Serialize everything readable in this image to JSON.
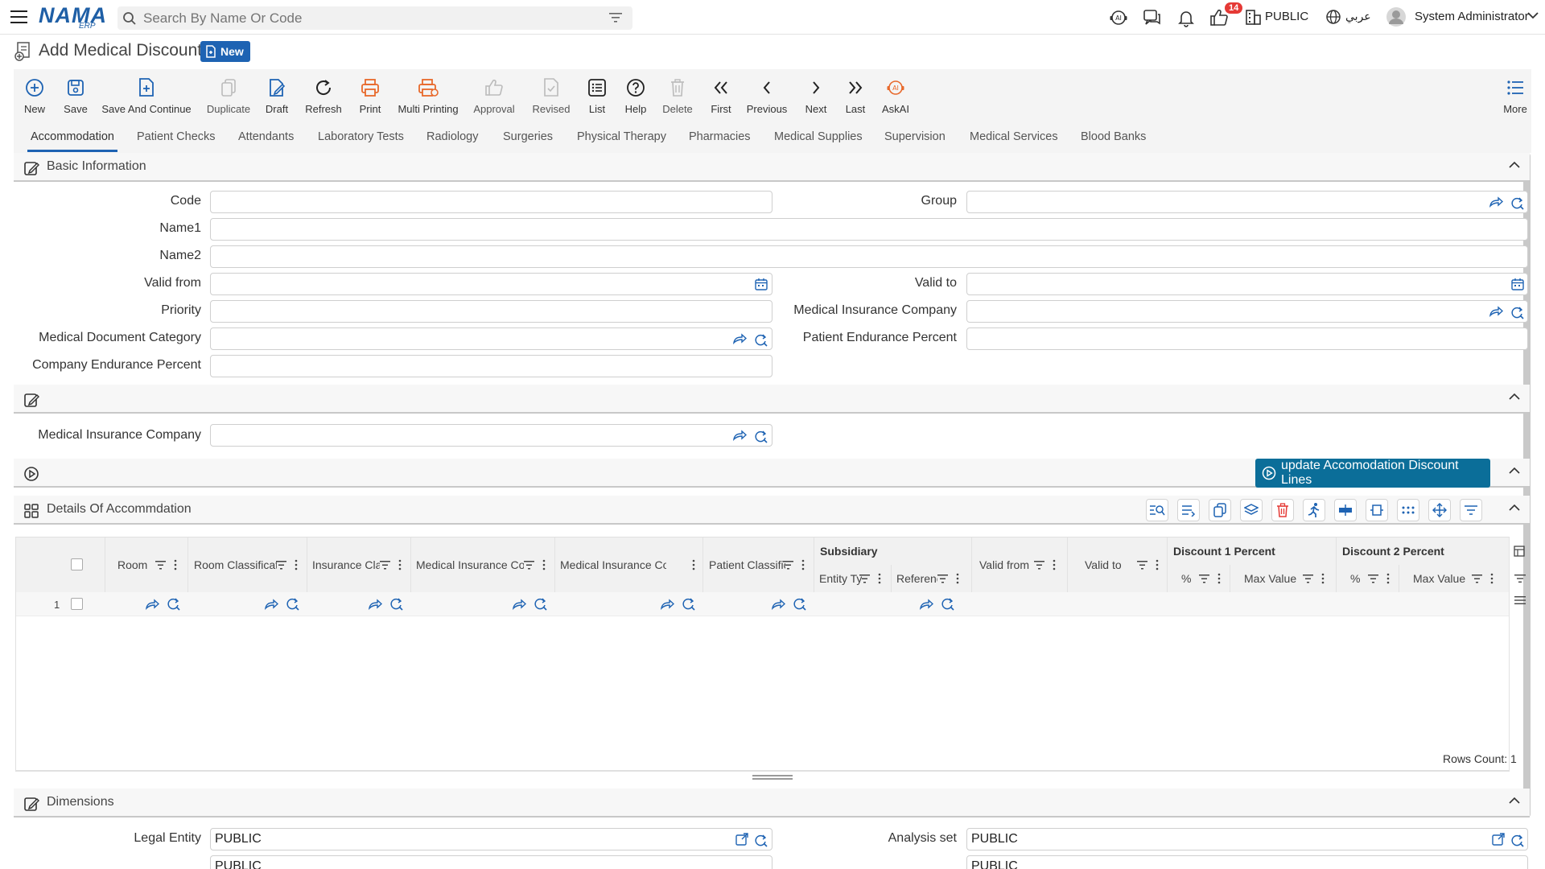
{
  "topbar": {
    "logo_main": "NAMA",
    "logo_sub": "ERP",
    "search_placeholder": "Search By Name Or Code",
    "notification_count": "14",
    "company": "PUBLIC",
    "language": "عربي",
    "user": "System Administrator"
  },
  "page": {
    "title": "Add Medical Discount",
    "status": "New"
  },
  "toolbar": {
    "new": "New",
    "save": "Save",
    "save_continue": "Save And Continue",
    "duplicate": "Duplicate",
    "draft": "Draft",
    "refresh": "Refresh",
    "print": "Print",
    "multi_printing": "Multi Printing",
    "approval": "Approval",
    "revised": "Revised",
    "list": "List",
    "help": "Help",
    "delete": "Delete",
    "first": "First",
    "previous": "Previous",
    "next": "Next",
    "last": "Last",
    "askai": "AskAI",
    "more": "More"
  },
  "tabs": [
    "Accommodation",
    "Patient Checks",
    "Attendants",
    "Laboratory Tests",
    "Radiology",
    "Surgeries",
    "Physical Therapy",
    "Pharmacies",
    "Medical Supplies",
    "Supervision",
    "Medical Services",
    "Blood Banks"
  ],
  "basic_info": {
    "title": "Basic Information",
    "code": "Code",
    "group": "Group",
    "name1": "Name1",
    "name2": "Name2",
    "valid_from": "Valid from",
    "valid_to": "Valid to",
    "priority": "Priority",
    "medical_insurance_company": "Medical Insurance Company",
    "medical_document_category": "Medical Document Category",
    "patient_endurance_percent": "Patient Endurance Percent",
    "company_endurance_percent": "Company Endurance Percent"
  },
  "section2": {
    "medical_insurance_company": "Medical Insurance Company"
  },
  "action": {
    "update_button": "update Accomodation Discount Lines"
  },
  "details": {
    "title": "Details Of Accommdation",
    "columns": {
      "room": "Room",
      "room_classification": "Room Classification",
      "insurance_class": "Insurance Class",
      "medical_insurance_company": "Medical Insurance Company",
      "medical_insurance_contract": "Medical Insurance Contract",
      "patient_classification": "Patient Classification",
      "subsidiary": "Subsidiary",
      "entity_type": "Entity Type",
      "reference": "Reference",
      "valid_from": "Valid from",
      "valid_to": "Valid to",
      "discount1": "Discount 1 Percent",
      "discount2": "Discount 2 Percent",
      "percent": "%",
      "max_value": "Max Value"
    },
    "row_number": "1",
    "rows_count": "Rows Count: 1"
  },
  "dimensions": {
    "title": "Dimensions",
    "legal_entity_label": "Legal Entity",
    "legal_entity_value": "PUBLIC",
    "analysis_set_label": "Analysis set",
    "analysis_set_value": "PUBLIC",
    "row3_left_value": "PUBLIC",
    "row3_right_value": "PUBLIC"
  },
  "colors": {
    "primary": "#1e63b3",
    "accent_orange": "#e8692b",
    "action_button": "#0b6e99",
    "badge_red": "#e53935"
  }
}
